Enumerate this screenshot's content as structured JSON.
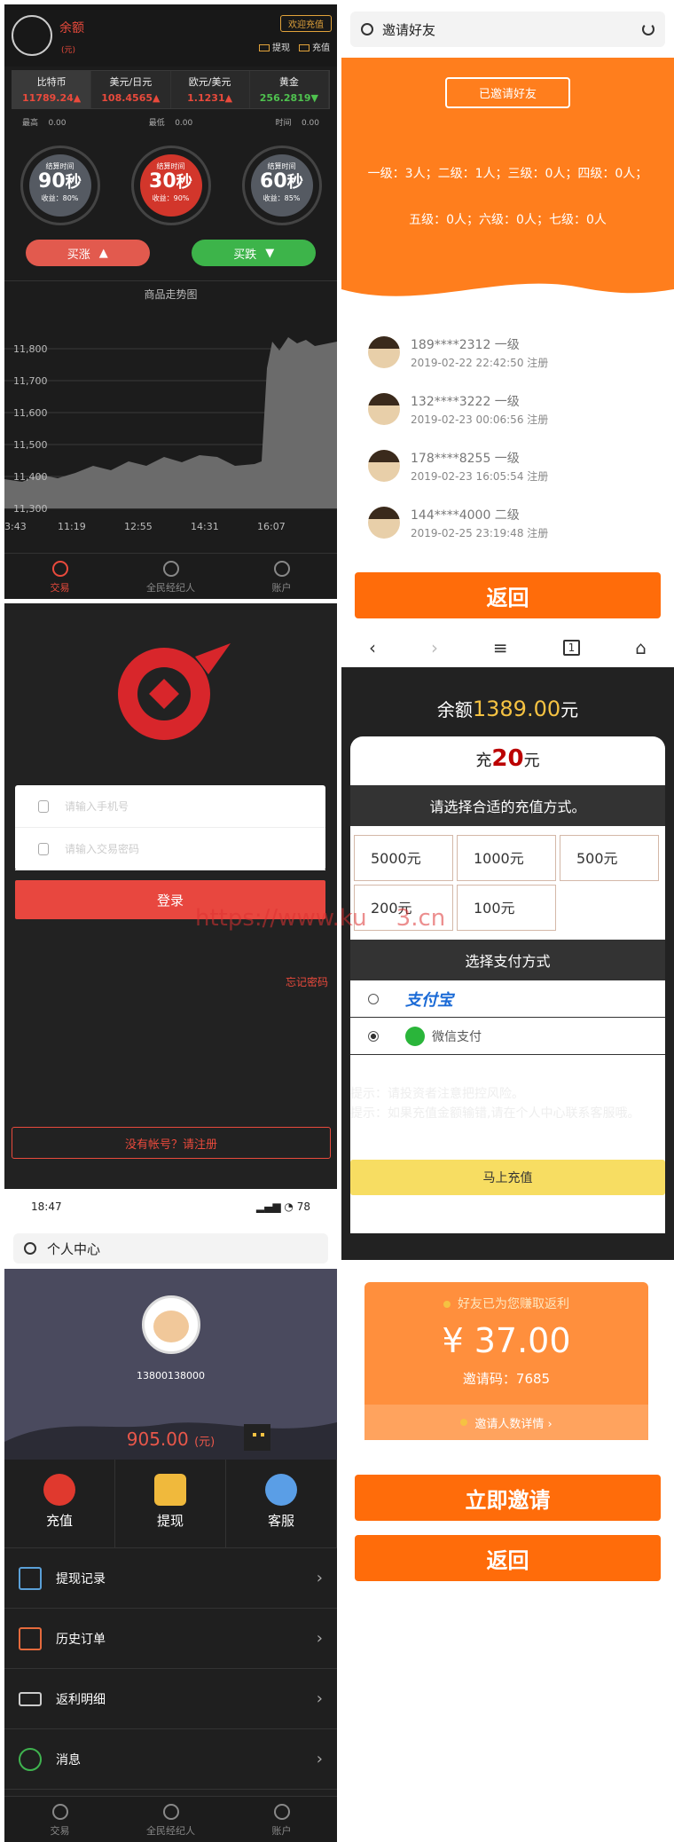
{
  "trade": {
    "balance_label": "余额",
    "balance_unit": "(元)",
    "welcome": "欢迎充值",
    "withdraw": "提现",
    "recharge": "充值",
    "tickers": [
      {
        "name": "比特币",
        "value": "11789.24▲",
        "dir": "up"
      },
      {
        "name": "美元/日元",
        "value": "108.4565▲",
        "dir": "up"
      },
      {
        "name": "欧元/美元",
        "value": "1.1231▲",
        "dir": "up"
      },
      {
        "name": "黄金",
        "value": "256.2819▼",
        "dir": "dn"
      }
    ],
    "stats": {
      "high_label": "最高",
      "high": "0.00",
      "low_label": "最低",
      "low": "0.00",
      "time_label": "时间",
      "time": "0.00"
    },
    "timers": [
      {
        "caption": "结算时间",
        "seconds": "90",
        "unit": "秒",
        "profit": "收益：80%"
      },
      {
        "caption": "结算时间",
        "seconds": "30",
        "unit": "秒",
        "profit": "收益：90%"
      },
      {
        "caption": "结算时间",
        "seconds": "60",
        "unit": "秒",
        "profit": "收益：85%"
      }
    ],
    "buy_up": "买涨",
    "buy_down": "买跌",
    "chart_title": "商品走势图",
    "chart_y_ticks": [
      "11,800",
      "11,700",
      "11,600",
      "11,500",
      "11,400",
      "11,300"
    ],
    "chart_x_ticks": [
      "3:43",
      "11:19",
      "12:55",
      "14:31",
      "16:07"
    ],
    "nav": [
      "交易",
      "全民经纪人",
      "账户"
    ]
  },
  "invite": {
    "search_text": "邀请好友",
    "invited_button": "已邀请好友",
    "levels_line1": "一级：3人；二级：1人；三级：0人；四级：0人；",
    "levels_line2": "五级：0人；六级：0人；七级：0人",
    "list": [
      {
        "name": "189****2312 一级",
        "date": "2019-02-22 22:42:50 注册"
      },
      {
        "name": "132****3222 一级",
        "date": "2019-02-23 00:06:56 注册"
      },
      {
        "name": "178****8255 一级",
        "date": "2019-02-23 16:05:54 注册"
      },
      {
        "name": "144****4000 二级",
        "date": "2019-02-25 23:19:48 注册"
      }
    ],
    "back": "返回"
  },
  "browser_nav": {
    "back": "‹",
    "forward": "›",
    "menu": "≡",
    "tabs": "1",
    "home": "⌂"
  },
  "login": {
    "phone_placeholder": "请输入手机号",
    "pwd_placeholder": "请输入交易密码",
    "login_button": "登录",
    "forgot": "忘记密码",
    "register": "没有帐号？请注册"
  },
  "watermark": "https://www.ku",
  "watermark2": "3.cn",
  "recharge": {
    "balance_label": "余额",
    "balance": "1389.00",
    "balance_unit": "元",
    "charge_prefix": "充",
    "charge_amount": "20",
    "charge_unit": "元",
    "method_title": "请选择合适的充值方式。",
    "options": [
      "5000元",
      "1000元",
      "500元",
      "200元",
      "100元"
    ],
    "pay_title": "选择支付方式",
    "alipay": "支付宝",
    "wechat": "微信支付",
    "tip1": "提示：请投资者注意把控风险。",
    "tip2": "提示：如果充值金额输错,请在个人中心联系客服哦。",
    "submit": "马上充值"
  },
  "status_bar": {
    "time": "18:47",
    "battery": "78"
  },
  "center": {
    "search_text": "个人中心",
    "phone": "13800138000",
    "money": "905.00",
    "money_unit": "(元)",
    "actions": [
      {
        "label": "充值",
        "color": "#e0392e"
      },
      {
        "label": "提现",
        "color": "#f0b93c"
      },
      {
        "label": "客服",
        "color": "#5a9ee6"
      }
    ],
    "rows": [
      "提现记录",
      "历史订单",
      "返利明细",
      "消息"
    ],
    "nav": [
      "交易",
      "全民经纪人",
      "账户"
    ]
  },
  "reward": {
    "title": "好友已为您赚取返利",
    "amount": "¥ 37.00",
    "code": "邀请码：7685",
    "detail": "邀请人数详情 ›",
    "invite_now": "立即邀请",
    "back": "返回"
  }
}
